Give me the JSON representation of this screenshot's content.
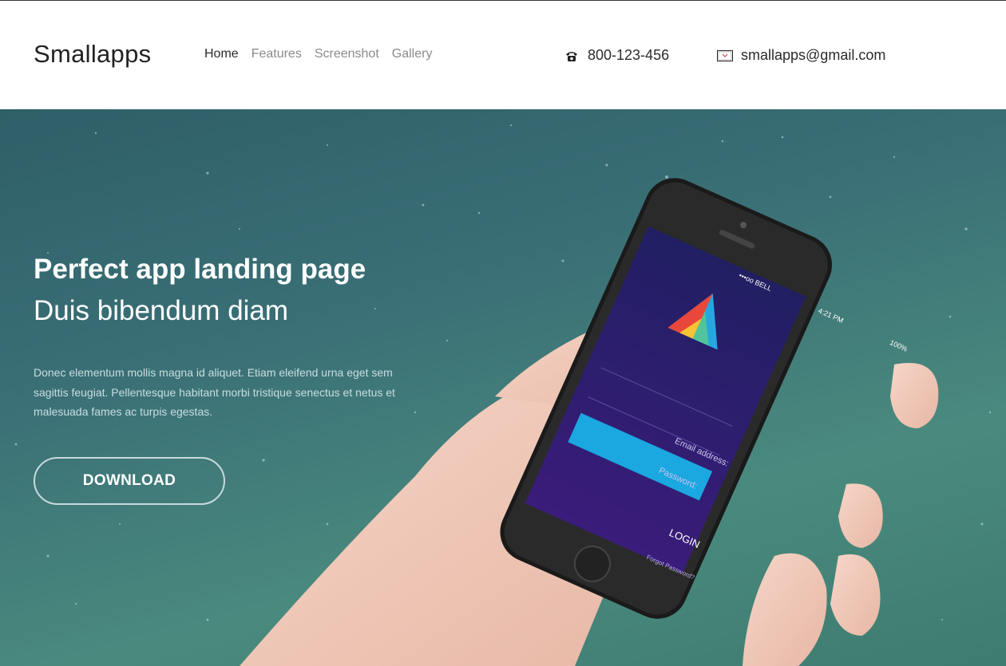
{
  "header": {
    "brand": "Smallapps",
    "nav": [
      {
        "label": "Home",
        "active": true
      },
      {
        "label": "Features",
        "active": false
      },
      {
        "label": "Screenshot",
        "active": false
      },
      {
        "label": "Gallery",
        "active": false
      }
    ],
    "phone": {
      "icon": "phone-icon",
      "text": "800-123-456"
    },
    "email": {
      "icon": "envelope-icon",
      "text": "smallapps@gmail.com"
    }
  },
  "hero": {
    "title": "Perfect app landing page",
    "subtitle": "Duis bibendum diam",
    "description": "Donec elementum mollis magna id aliquet. Etiam eleifend urna eget sem sagittis feugiat. Pellentesque habitant morbi tristique senectus et netus et malesuada fames ac turpis egestas.",
    "button": "DOWNLOAD"
  },
  "phone_screen": {
    "carrier": "•••oo BELL",
    "time": "4:21 PM",
    "battery": "100%",
    "email_placeholder": "Email address:",
    "password_placeholder": "Password:",
    "login_label": "LOGIN",
    "forgot_label": "Forgot Password?"
  },
  "colors": {
    "hero_bg": "#3a6f76",
    "screen_bg": "#2b1f6e",
    "login_button": "#1ba7e0"
  }
}
